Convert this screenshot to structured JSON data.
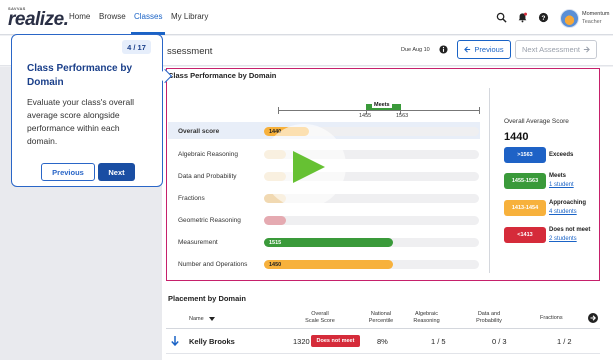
{
  "nav": {
    "logo_small": "SAVVAS",
    "logo_big": "realize.",
    "links": [
      {
        "label": "Home"
      },
      {
        "label": "Browse"
      },
      {
        "label": "Classes"
      },
      {
        "label": "My Library"
      }
    ],
    "user": {
      "name": "Momentum",
      "role": "Teacher"
    }
  },
  "subheader": {
    "title": "ssessment",
    "due": "Due Aug 10",
    "previous_label": "Previous",
    "next_label": "Next Assessment"
  },
  "tour": {
    "step": "4 / 17",
    "title": "Class Performance by Domain",
    "body": "Evaluate your class's overall average score alongside performance within each domain.",
    "prev_label": "Previous",
    "next_label": "Next"
  },
  "class_performance": {
    "title": "Class Performance by Domain",
    "scale": {
      "band_label": "Meets",
      "low": "1455",
      "high": "1563"
    },
    "rows": [
      {
        "label": "Overall score",
        "value": "1440",
        "fraction": 0.21,
        "color": "#f7b13c"
      },
      {
        "label": "Algebraic Reasoning",
        "value": "",
        "fraction": 0.0,
        "color": "#f7b13c"
      },
      {
        "label": "Data and Probability",
        "value": "",
        "fraction": 0.0,
        "color": "#f7b13c"
      },
      {
        "label": "Fractions",
        "value": "",
        "fraction": 0.0,
        "color": "#f7b13c"
      },
      {
        "label": "Geometric Reasoning",
        "value": "",
        "fraction": 0.0,
        "color": "#d52b3a"
      },
      {
        "label": "Measurement",
        "value": "1515",
        "fraction": 0.6,
        "color": "#3a9a3a"
      },
      {
        "label": "Number and Operations",
        "value": "1450",
        "fraction": 0.6,
        "color": "#f7b13c"
      }
    ],
    "overall_label": "Overall Average Score",
    "overall_score": "1440",
    "legend": [
      {
        "range": ">1563",
        "name": "Exceeds",
        "link": "",
        "color": "#1e62c6"
      },
      {
        "range": "1455-1563",
        "name": "Meets",
        "link": "1 student",
        "color": "#3a9a3a"
      },
      {
        "range": "1413-1454",
        "name": "Approaching",
        "link": "4 students",
        "color": "#f7b13c"
      },
      {
        "range": "<1413",
        "name": "Does not meet",
        "link": "2 students",
        "color": "#d52b3a"
      }
    ]
  },
  "placement": {
    "title": "Placement by Domain",
    "headers": {
      "name": "Name",
      "scale_score": "Overall Scale Score",
      "percentile": "National Percentile",
      "algebraic": "Algebraic Reasoning",
      "data_prob": "Data and Probability",
      "fractions": "Fractions"
    },
    "rows": [
      {
        "name": "Kelly Brooks",
        "score": "1320",
        "badge": "Does not meet",
        "percentile": "8%",
        "algebraic": "1 / 5",
        "data_prob": "0 / 3",
        "fractions": "1 / 2"
      }
    ]
  },
  "colors": {
    "accent": "#1a63c6",
    "tour_border": "#2a66c7",
    "highlight": "#c6206b"
  }
}
